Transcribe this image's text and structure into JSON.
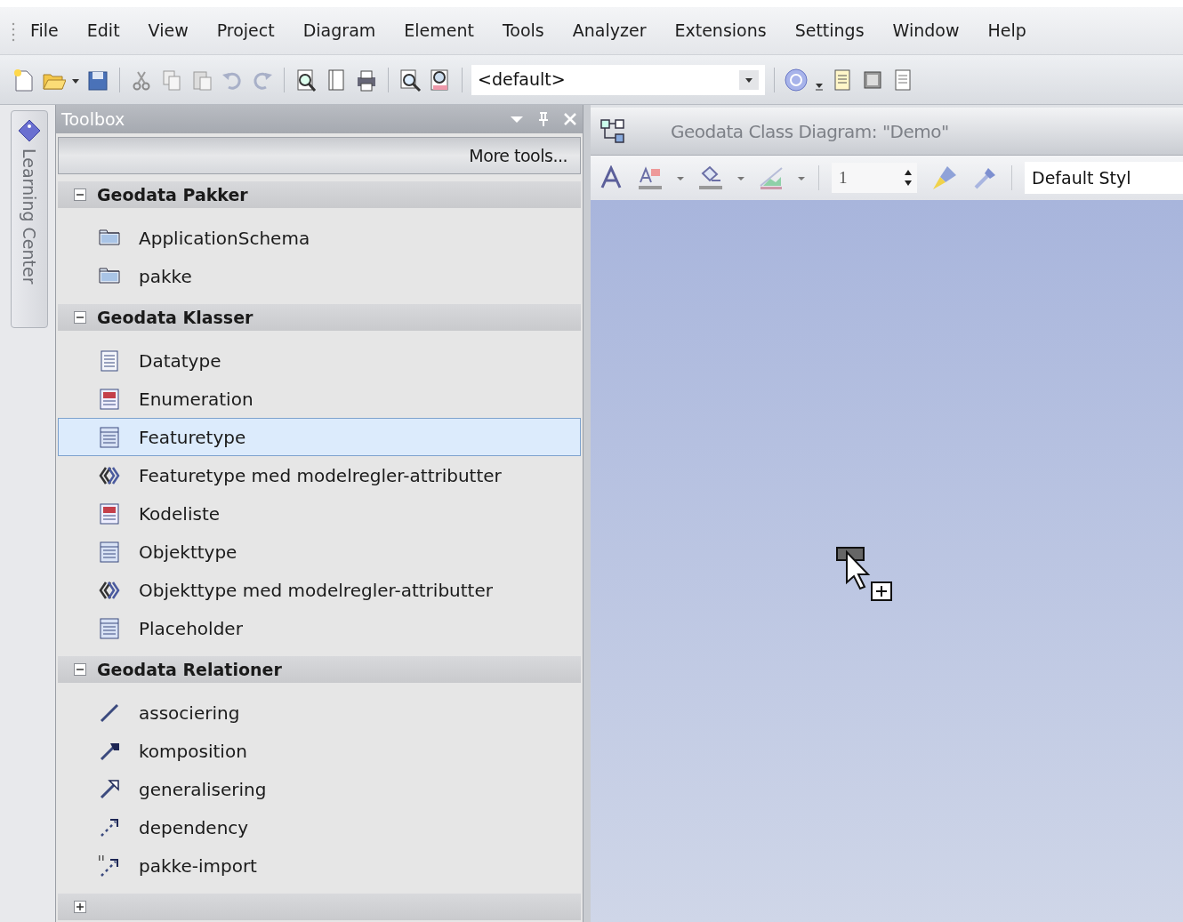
{
  "menu": [
    {
      "label": "File"
    },
    {
      "label": "Edit"
    },
    {
      "label": "View"
    },
    {
      "label": "Project"
    },
    {
      "label": "Diagram"
    },
    {
      "label": "Element"
    },
    {
      "label": "Tools"
    },
    {
      "label": "Analyzer"
    },
    {
      "label": "Extensions"
    },
    {
      "label": "Settings"
    },
    {
      "label": "Window"
    },
    {
      "label": "Help"
    }
  ],
  "toolbar": {
    "perspective": {
      "value": "<default>"
    }
  },
  "side_tab": {
    "label": "Learning Center"
  },
  "toolbox": {
    "title": "Toolbox",
    "more_tools": "More tools...",
    "groups": [
      {
        "label": "Geodata Pakker",
        "expanded": true,
        "items": [
          {
            "label": "ApplicationSchema",
            "kind": "package",
            "selected": false
          },
          {
            "label": "pakke",
            "kind": "package",
            "selected": false
          }
        ]
      },
      {
        "label": "Geodata Klasser",
        "expanded": true,
        "items": [
          {
            "label": "Datatype",
            "kind": "datatype",
            "selected": false
          },
          {
            "label": "Enumeration",
            "kind": "enumeration",
            "selected": false
          },
          {
            "label": "Featuretype",
            "kind": "class",
            "selected": true
          },
          {
            "label": "Featuretype med modelregler-attributter",
            "kind": "stereotype",
            "selected": false
          },
          {
            "label": "Kodeliste",
            "kind": "enumeration",
            "selected": false
          },
          {
            "label": "Objekttype",
            "kind": "class",
            "selected": false
          },
          {
            "label": "Objekttype med modelregler-attributter",
            "kind": "stereotype",
            "selected": false
          },
          {
            "label": "Placeholder",
            "kind": "class",
            "selected": false
          }
        ]
      },
      {
        "label": "Geodata Relationer",
        "expanded": true,
        "items": [
          {
            "label": "associering",
            "kind": "association",
            "selected": false
          },
          {
            "label": "komposition",
            "kind": "composition",
            "selected": false
          },
          {
            "label": "generalisering",
            "kind": "generalization",
            "selected": false
          },
          {
            "label": "dependency",
            "kind": "dependency",
            "selected": false
          },
          {
            "label": "pakke-import",
            "kind": "import",
            "selected": false
          }
        ]
      },
      {
        "expanded": false
      }
    ]
  },
  "diagram": {
    "title": "Geodata Class Diagram: \"Demo\"",
    "line_width": {
      "value": "1"
    },
    "style": {
      "value": "Default Styl"
    }
  }
}
